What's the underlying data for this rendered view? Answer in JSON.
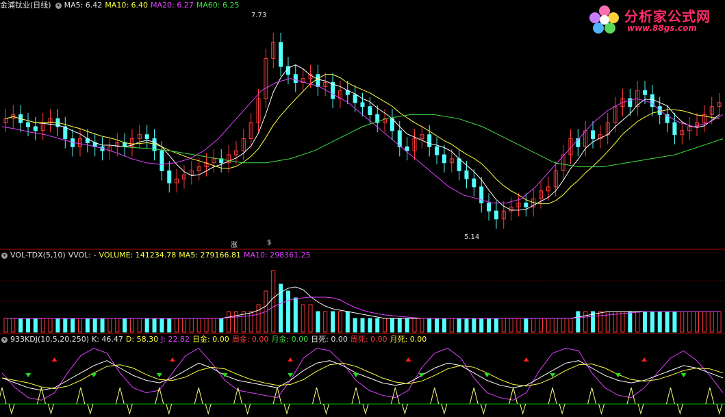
{
  "price_panel": {
    "title": "金浦钛业(日线)",
    "ma5": "MA5: 6.42",
    "ma10": "MA10: 6.40",
    "ma20": "MA20: 6.27",
    "ma60": "MA60: 6.25",
    "high_label": "7.73",
    "low_label": "5.14",
    "marker_zhang": "涨",
    "marker_s": "$"
  },
  "volume_panel": {
    "indicator": "VOL-TDX(5,10)",
    "vvol": "VVOL: -",
    "volume": "VOLUME: 141234.78",
    "ma5": "MA5: 279166.81",
    "ma10": "MA10: 298361.25"
  },
  "kdj_panel": {
    "indicator": "933KDJ(10,5,20,250)",
    "k": "K: 46.47",
    "d": "D: 58.30",
    "j": "J: 22.82",
    "rijin": "日金: 0.00",
    "zhoujin": "周金: 0.00",
    "yuejin": "月金: 0.00",
    "risi": "日死: 0.00",
    "zhousi": "周死: 0.00",
    "yuesi": "月死: 0.00"
  },
  "watermark": {
    "title": "分析家公式网",
    "url": "www.88gs.com"
  },
  "colors": {
    "up": "#ff3b3b",
    "down": "#54ffff",
    "ma5": "#ffffff",
    "ma10": "#ffff40",
    "ma20": "#e040ff",
    "ma60": "#40e040",
    "divider": "#b00000"
  },
  "chart_data": {
    "type": "line",
    "price_series": [
      6.55,
      6.6,
      6.5,
      6.45,
      6.4,
      6.5,
      6.55,
      6.45,
      6.3,
      6.2,
      6.3,
      6.25,
      6.2,
      6.15,
      6.2,
      6.25,
      6.2,
      6.3,
      6.35,
      6.3,
      6.15,
      5.9,
      5.75,
      5.8,
      5.85,
      5.9,
      5.95,
      6.0,
      6.05,
      6.0,
      6.1,
      6.15,
      6.3,
      6.5,
      6.8,
      7.3,
      7.5,
      7.2,
      7.1,
      7.0,
      7.05,
      7.1,
      6.95,
      7.0,
      6.8,
      6.9,
      6.85,
      6.75,
      6.7,
      6.6,
      6.5,
      6.55,
      6.4,
      6.2,
      6.15,
      6.3,
      6.35,
      6.2,
      6.1,
      6.0,
      6.05,
      5.9,
      5.8,
      5.7,
      5.5,
      5.4,
      5.3,
      5.4,
      5.45,
      5.5,
      5.45,
      5.55,
      5.65,
      5.7,
      5.9,
      6.1,
      6.3,
      6.2,
      6.4,
      6.3,
      6.35,
      6.5,
      6.7,
      6.8,
      6.7,
      6.9,
      6.85,
      6.7,
      6.6,
      6.5,
      6.35,
      6.4,
      6.45,
      6.5,
      6.6,
      6.7,
      6.75
    ],
    "ma20_series": [
      6.45,
      6.42,
      6.38,
      6.35,
      6.3,
      6.25,
      6.22,
      6.18,
      6.12,
      6.05,
      6.0,
      5.98,
      6.0,
      6.05,
      6.15,
      6.3,
      6.5,
      6.7,
      6.9,
      7.0,
      7.05,
      7.0,
      6.95,
      6.85,
      6.75,
      6.6,
      6.45,
      6.3,
      6.15,
      6.0,
      5.85,
      5.7,
      5.6,
      5.55,
      5.5,
      5.5,
      5.55,
      5.7,
      5.9,
      6.1,
      6.3,
      6.5,
      6.65,
      6.75,
      6.8,
      6.75,
      6.6,
      6.5,
      6.45,
      6.5,
      6.6
    ],
    "ma60_series": [
      6.2,
      6.18,
      6.15,
      6.1,
      6.05,
      6.0,
      6.0,
      6.05,
      6.15,
      6.3,
      6.45,
      6.55,
      6.6,
      6.6,
      6.55,
      6.45,
      6.3,
      6.15,
      6.0,
      5.95,
      5.95,
      6.0,
      6.05,
      6.1,
      6.2,
      6.3
    ],
    "volume_series": [
      2,
      2,
      2,
      2,
      2,
      2,
      2,
      2,
      2,
      2,
      2,
      2,
      2,
      2,
      2,
      2,
      2,
      2,
      2,
      2,
      2,
      2,
      2,
      2,
      2,
      2,
      2,
      2,
      2,
      2,
      3,
      3,
      3,
      3,
      4,
      6,
      9,
      7,
      6,
      5,
      4,
      4,
      3,
      3,
      3,
      3,
      3,
      2,
      2,
      2,
      2,
      2,
      2,
      2,
      2,
      2,
      2,
      2,
      2,
      2,
      2,
      2,
      2,
      2,
      2,
      2,
      2,
      2,
      2,
      2,
      2,
      2,
      2,
      2,
      2,
      2,
      2,
      3,
      3,
      3,
      3,
      3,
      3,
      3,
      3,
      3,
      3,
      3,
      3,
      3,
      3,
      3,
      3,
      3,
      3,
      3,
      3
    ],
    "kdj_k": [
      50,
      40,
      30,
      25,
      30,
      45,
      60,
      75,
      85,
      70,
      55,
      45,
      40,
      50,
      65,
      80,
      70,
      55,
      45,
      40,
      35,
      30,
      45,
      65,
      80,
      85,
      75,
      60,
      50,
      40,
      35,
      40,
      55,
      70,
      80,
      75,
      60,
      45,
      35,
      30,
      35,
      50,
      65,
      80,
      85,
      70,
      55,
      45,
      40,
      45,
      55,
      65,
      75,
      70,
      60,
      50
    ],
    "kdj_j": [
      60,
      30,
      10,
      5,
      20,
      60,
      95,
      110,
      100,
      60,
      30,
      20,
      25,
      60,
      95,
      110,
      80,
      45,
      25,
      20,
      15,
      10,
      45,
      90,
      110,
      105,
      80,
      45,
      25,
      15,
      10,
      25,
      70,
      100,
      110,
      90,
      50,
      20,
      10,
      5,
      20,
      65,
      100,
      110,
      105,
      60,
      30,
      15,
      10,
      30,
      60,
      90,
      105,
      85,
      55,
      20
    ],
    "xmin": 0,
    "xmax": 96
  }
}
